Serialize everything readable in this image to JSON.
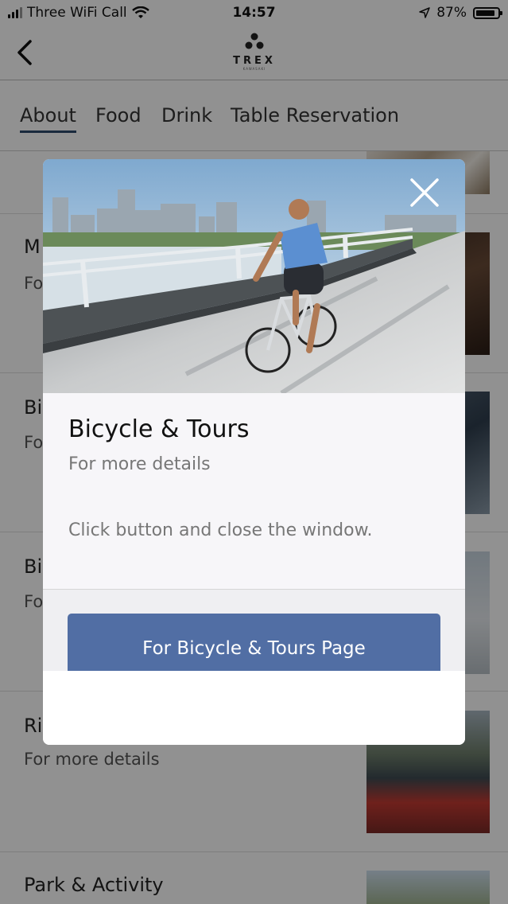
{
  "status_bar": {
    "carrier": "Three WiFi Call",
    "time": "14:57",
    "battery": "87%"
  },
  "header": {
    "logo_text": "TREX",
    "logo_subtext": "KAWASAKI"
  },
  "tabs": [
    "About",
    "Food",
    "Drink",
    "Table Reservation"
  ],
  "list": [
    {
      "title": "M",
      "subtitle": "Fo"
    },
    {
      "title": "Bi",
      "subtitle": "Fo"
    },
    {
      "title": "Bi",
      "subtitle": "Fo"
    },
    {
      "title": "Riv",
      "subtitle": "For more details"
    },
    {
      "title": "Park & Activity",
      "subtitle": ""
    }
  ],
  "modal": {
    "title": "Bicycle & Tours",
    "subtitle": "For more details",
    "message": "Click button and close the window.",
    "button_label": "For Bicycle & Tours Page"
  },
  "colors": {
    "accent": "#516ea4",
    "tab_underline": "#2f4a6b"
  }
}
